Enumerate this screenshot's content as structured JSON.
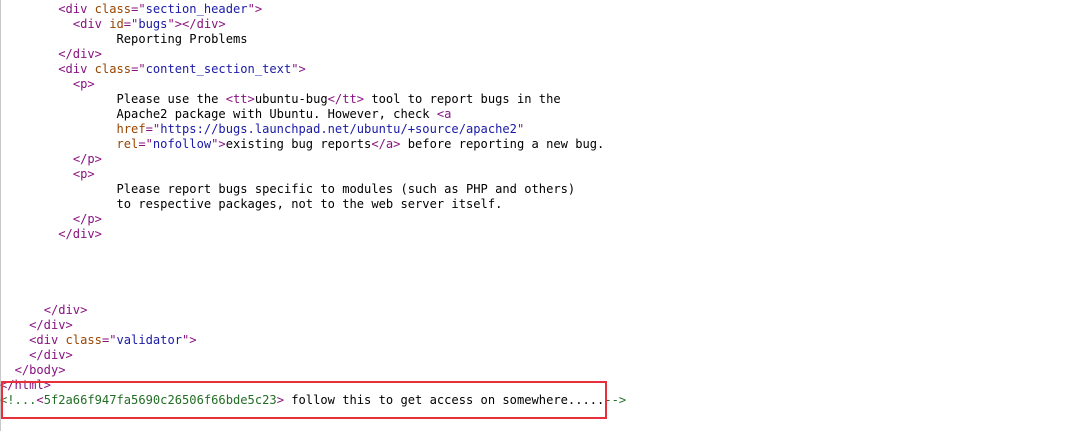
{
  "source_lines": [
    {
      "indent": "        ",
      "parts": [
        {
          "k": "tag",
          "t": "<div "
        },
        {
          "k": "attr",
          "t": "class"
        },
        {
          "k": "tag",
          "t": "=\""
        },
        {
          "k": "val",
          "t": "section_header"
        },
        {
          "k": "tag",
          "t": "\">"
        }
      ]
    },
    {
      "indent": "          ",
      "parts": [
        {
          "k": "tag",
          "t": "<div "
        },
        {
          "k": "attr",
          "t": "id"
        },
        {
          "k": "tag",
          "t": "=\""
        },
        {
          "k": "val",
          "t": "bugs"
        },
        {
          "k": "tag",
          "t": "\"></div>"
        }
      ]
    },
    {
      "indent": "                ",
      "parts": [
        {
          "k": "text",
          "t": "Reporting Problems"
        }
      ]
    },
    {
      "indent": "        ",
      "parts": [
        {
          "k": "tag",
          "t": "</div>"
        }
      ]
    },
    {
      "indent": "        ",
      "parts": [
        {
          "k": "tag",
          "t": "<div "
        },
        {
          "k": "attr",
          "t": "class"
        },
        {
          "k": "tag",
          "t": "=\""
        },
        {
          "k": "val",
          "t": "content_section_text"
        },
        {
          "k": "tag",
          "t": "\">"
        }
      ]
    },
    {
      "indent": "          ",
      "parts": [
        {
          "k": "tag",
          "t": "<p>"
        }
      ]
    },
    {
      "indent": "                ",
      "parts": [
        {
          "k": "text",
          "t": "Please use the "
        },
        {
          "k": "tag",
          "t": "<tt>"
        },
        {
          "k": "text",
          "t": "ubuntu-bug"
        },
        {
          "k": "tag",
          "t": "</tt>"
        },
        {
          "k": "text",
          "t": " tool to report bugs in the"
        }
      ]
    },
    {
      "indent": "                ",
      "parts": [
        {
          "k": "text",
          "t": "Apache2 package with Ubuntu. However, check "
        },
        {
          "k": "tag",
          "t": "<a"
        }
      ]
    },
    {
      "indent": "                ",
      "parts": [
        {
          "k": "attr",
          "t": "href"
        },
        {
          "k": "tag",
          "t": "=\""
        },
        {
          "k": "val",
          "t": "https://bugs.launchpad.net/ubuntu/+source/apache2"
        },
        {
          "k": "tag",
          "t": "\""
        }
      ]
    },
    {
      "indent": "                ",
      "parts": [
        {
          "k": "attr",
          "t": "rel"
        },
        {
          "k": "tag",
          "t": "=\""
        },
        {
          "k": "val",
          "t": "nofollow"
        },
        {
          "k": "tag",
          "t": "\">"
        },
        {
          "k": "text",
          "t": "existing bug reports"
        },
        {
          "k": "tag",
          "t": "</a>"
        },
        {
          "k": "text",
          "t": " before reporting a new bug."
        }
      ]
    },
    {
      "indent": "          ",
      "parts": [
        {
          "k": "tag",
          "t": "</p>"
        }
      ]
    },
    {
      "indent": "          ",
      "parts": [
        {
          "k": "tag",
          "t": "<p>"
        }
      ]
    },
    {
      "indent": "                ",
      "parts": [
        {
          "k": "text",
          "t": "Please report bugs specific to modules (such as PHP and others)"
        }
      ]
    },
    {
      "indent": "                ",
      "parts": [
        {
          "k": "text",
          "t": "to respective packages, not to the web server itself."
        }
      ]
    },
    {
      "indent": "          ",
      "parts": [
        {
          "k": "tag",
          "t": "</p>"
        }
      ]
    },
    {
      "indent": "        ",
      "parts": [
        {
          "k": "tag",
          "t": "</div>"
        }
      ]
    },
    {
      "indent": "",
      "parts": []
    },
    {
      "indent": "",
      "parts": []
    },
    {
      "indent": "",
      "parts": []
    },
    {
      "indent": "",
      "parts": []
    },
    {
      "indent": "      ",
      "parts": [
        {
          "k": "tag",
          "t": "</div>"
        }
      ]
    },
    {
      "indent": "    ",
      "parts": [
        {
          "k": "tag",
          "t": "</div>"
        }
      ]
    },
    {
      "indent": "    ",
      "parts": [
        {
          "k": "tag",
          "t": "<div "
        },
        {
          "k": "attr",
          "t": "class"
        },
        {
          "k": "tag",
          "t": "=\""
        },
        {
          "k": "val",
          "t": "validator"
        },
        {
          "k": "tag",
          "t": "\">"
        }
      ]
    },
    {
      "indent": "    ",
      "parts": [
        {
          "k": "tag",
          "t": "</div>"
        }
      ]
    },
    {
      "indent": "  ",
      "parts": [
        {
          "k": "tag",
          "t": "</body>"
        }
      ]
    },
    {
      "indent": "",
      "parts": [
        {
          "k": "tag",
          "t": "</html>"
        }
      ]
    },
    {
      "indent": "",
      "parts": [
        {
          "k": "comment",
          "t": "<!..."
        },
        {
          "k": "tag",
          "t": "<"
        },
        {
          "k": "comment",
          "t": "5f2a66f947fa5690c26506f66bde5c23"
        },
        {
          "k": "tag",
          "t": ">"
        },
        {
          "k": "text",
          "t": " follow this to get access on somewhere....."
        },
        {
          "k": "comment",
          "t": "-->"
        }
      ]
    }
  ],
  "highlight": {
    "color": "#e8303a",
    "first_line": 25,
    "last_line": 26
  },
  "colors": {
    "tag": "#881280",
    "attribute": "#994500",
    "value": "#1a1aa6",
    "text": "#000000",
    "comment": "#236e25"
  }
}
